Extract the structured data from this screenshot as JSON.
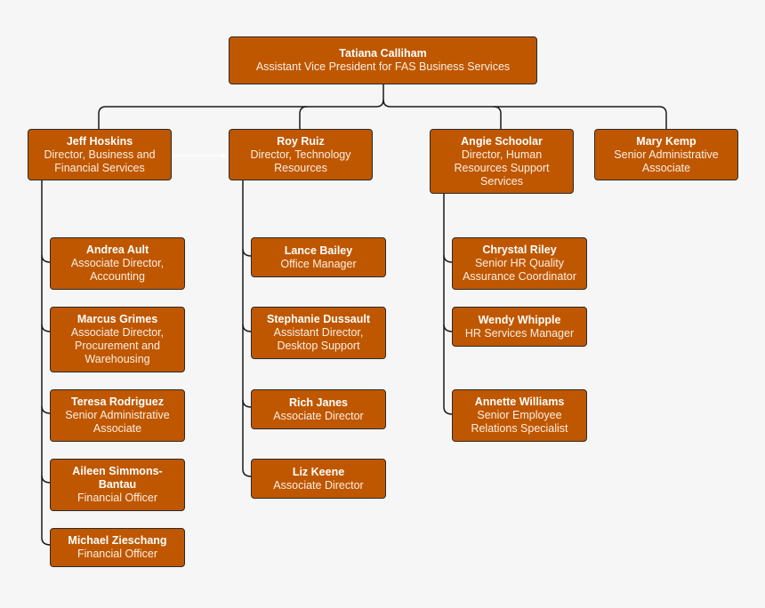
{
  "chart_title": "",
  "colors": {
    "box_fill": "#bf5700",
    "box_border": "#2a2a2a",
    "text": "#ffffff",
    "connector": "#1a1a1a",
    "background": "#f6f6f6"
  },
  "root": {
    "name": "Tatiana Calliham",
    "title": "Assistant Vice President for FAS Business Services"
  },
  "directors": [
    {
      "name": "Jeff Hoskins",
      "title": "Director, Business and Financial Services",
      "reports": [
        {
          "name": "Andrea Ault",
          "title": "Associate Director, Accounting"
        },
        {
          "name": "Marcus Grimes",
          "title": "Associate Director, Procurement and Warehousing"
        },
        {
          "name": "Teresa Rodriguez",
          "title": "Senior Administrative Associate"
        },
        {
          "name": "Aileen Simmons-Bantau",
          "title": "Financial Officer"
        },
        {
          "name": "Michael Zieschang",
          "title": "Financial Officer"
        }
      ]
    },
    {
      "name": "Roy Ruiz",
      "title": "Director, Technology Resources",
      "reports": [
        {
          "name": "Lance Bailey",
          "title": "Office Manager"
        },
        {
          "name": "Stephanie Dussault",
          "title": "Assistant Director, Desktop Support"
        },
        {
          "name": "Rich Janes",
          "title": "Associate Director"
        },
        {
          "name": "Liz Keene",
          "title": "Associate Director"
        }
      ]
    },
    {
      "name": "Angie Schoolar",
      "title": "Director, Human Resources Support Services",
      "reports": [
        {
          "name": "Chrystal Riley",
          "title": "Senior HR Quality Assurance Coordinator"
        },
        {
          "name": "Wendy Whipple",
          "title": "HR Services Manager"
        },
        {
          "name": "Annette Williams",
          "title": "Senior Employee Relations Specialist"
        }
      ]
    },
    {
      "name": "Mary Kemp",
      "title": "Senior Administrative Associate",
      "reports": []
    }
  ]
}
